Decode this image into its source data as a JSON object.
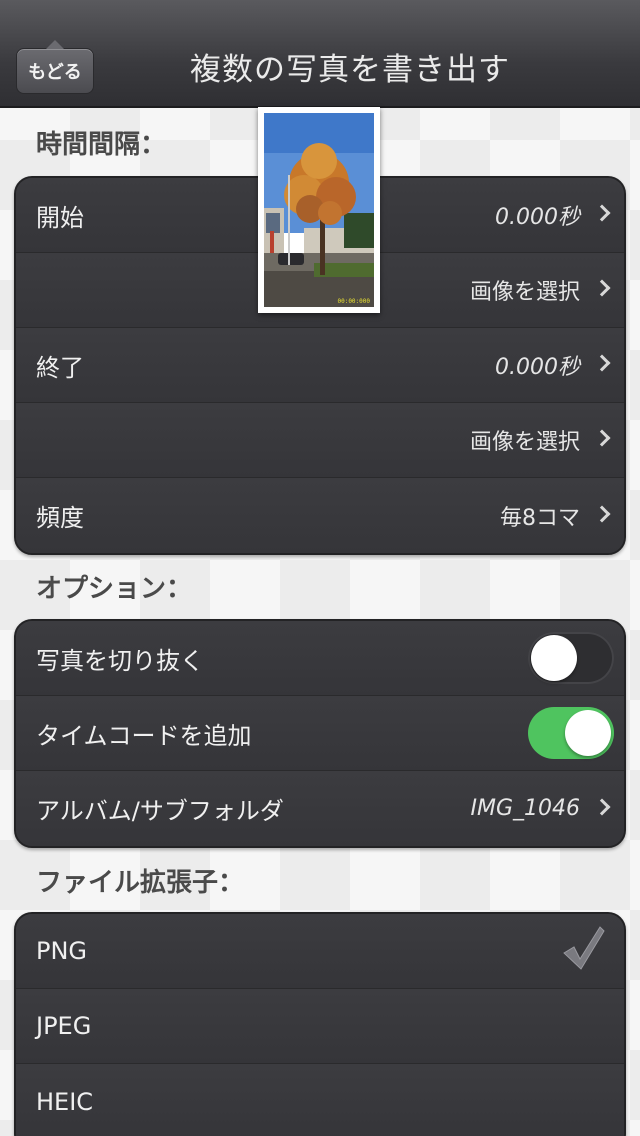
{
  "nav": {
    "back_label": "もどる",
    "title": "複数の写真を書き出す"
  },
  "sections": {
    "interval": {
      "header": "時間間隔：",
      "rows": [
        {
          "label": "開始",
          "value": "0.000秒"
        },
        {
          "label": "",
          "value": "画像を選択"
        },
        {
          "label": "終了",
          "value": "0.000秒"
        },
        {
          "label": "",
          "value": "画像を選択"
        },
        {
          "label": "頻度",
          "value": "毎8コマ"
        }
      ]
    },
    "options": {
      "header": "オプション：",
      "rows": [
        {
          "label": "写真を切り抜く",
          "toggle": false
        },
        {
          "label": "タイムコードを追加",
          "toggle": true
        },
        {
          "label": "アルバム/サブフォルダ",
          "value": "IMG_1046"
        }
      ]
    },
    "file_ext": {
      "header": "ファイル拡張子：",
      "rows": [
        {
          "label": "PNG",
          "selected": true
        },
        {
          "label": "JPEG",
          "selected": false
        },
        {
          "label": "HEIC",
          "selected": false
        }
      ]
    }
  },
  "thumbnail": {
    "timecode": "00:00:000"
  },
  "colors": {
    "toggle_on": "#4fc45f",
    "group_bg": "#38383c",
    "navbar": "#3a3a3e"
  }
}
